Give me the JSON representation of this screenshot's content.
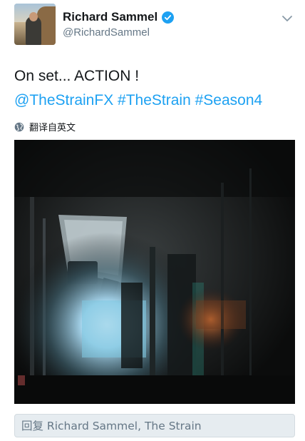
{
  "author": {
    "display_name": "Richard Sammel",
    "handle": "@RichardSammel",
    "verified": true
  },
  "tweet": {
    "text_line1": "On set... ACTION !",
    "mentions_and_tags": [
      {
        "text": "@TheStrainFX",
        "kind": "mention"
      },
      {
        "text": "#TheStrain",
        "kind": "hashtag"
      },
      {
        "text": "#Season4",
        "kind": "hashtag"
      }
    ]
  },
  "translate": {
    "label": "翻译自英文",
    "icon": "globe-icon"
  },
  "media": {
    "icon": "photo",
    "description_kind": "image"
  },
  "reply": {
    "placeholder": "回复 Richard Sammel, The Strain"
  },
  "colors": {
    "link": "#1da1f2",
    "text": "#14171a",
    "secondary": "#657786",
    "reply_bg": "#e6ecf0"
  }
}
